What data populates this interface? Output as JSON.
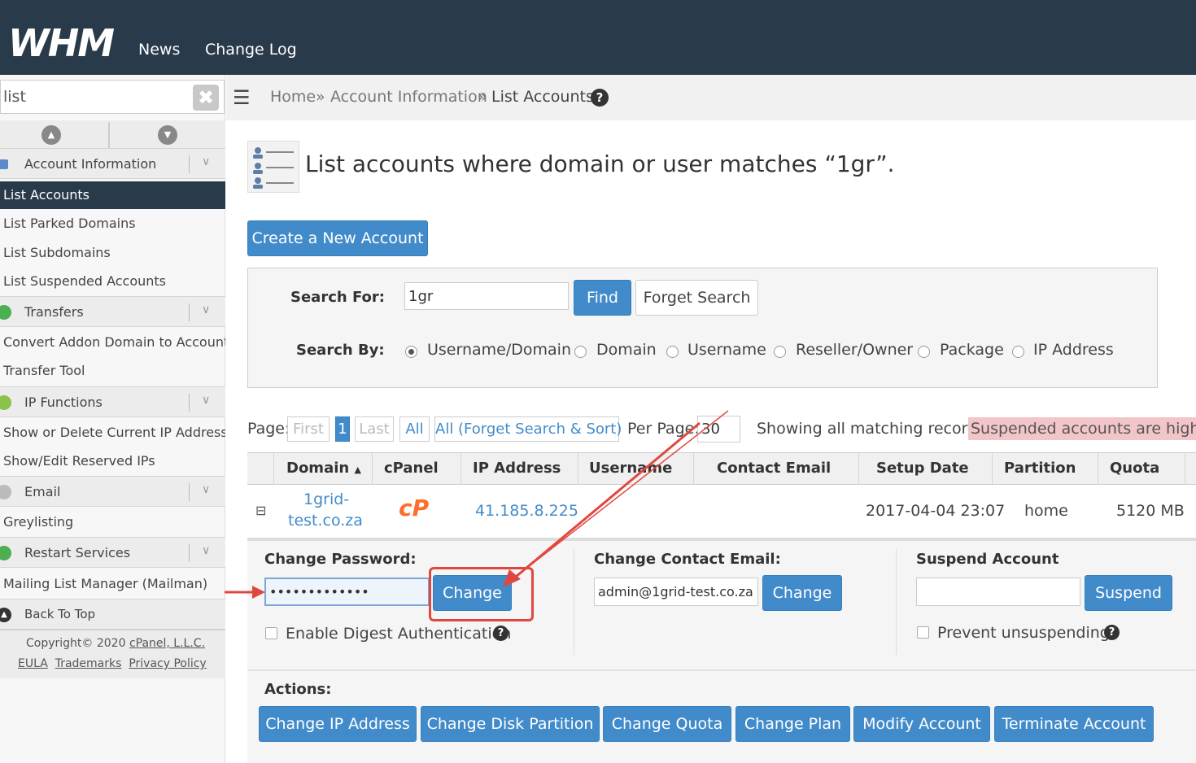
{
  "header": {
    "logo": "WHM",
    "nav": [
      "News",
      "Change Log"
    ]
  },
  "sidebar": {
    "search_value": "list",
    "groups": [
      {
        "label": "Account Information",
        "icon_color": "#5a8ac6",
        "items": [
          "List Accounts",
          "List Parked Domains",
          "List Subdomains",
          "List Suspended Accounts"
        ]
      },
      {
        "label": "Transfers",
        "icon_color": "#4caf50",
        "items": [
          "Convert Addon Domain to Account",
          "Transfer Tool"
        ]
      },
      {
        "label": "IP Functions",
        "icon_color": "#8bc34a",
        "items": [
          "Show or Delete Current IP Addresses",
          "Show/Edit Reserved IPs"
        ]
      },
      {
        "label": "Email",
        "icon_color": "#bbbbbb",
        "items": [
          "Greylisting"
        ]
      },
      {
        "label": "Restart Services",
        "icon_color": "#4caf50",
        "items": [
          "Mailing List Manager (Mailman)"
        ]
      }
    ],
    "back_to_top": "Back To Top",
    "copyright_prefix": "Copyright© 2020 ",
    "copyright_company": "cPanel, L.L.C.",
    "footer_links": [
      "EULA",
      "Trademarks",
      "Privacy Policy"
    ]
  },
  "breadcrumb": [
    "Home",
    "Account Information",
    "List Accounts"
  ],
  "page_title": "List accounts where domain or user matches “1gr”.",
  "create_button": "Create a New Account",
  "search": {
    "for_label": "Search For:",
    "value": "1gr",
    "find_button": "Find",
    "forget_button": "Forget Search",
    "by_label": "Search By:",
    "options": [
      "Username/Domain",
      "Domain",
      "Username",
      "Reseller/Owner",
      "Package",
      "IP Address"
    ],
    "selected": "Username/Domain"
  },
  "pagination": {
    "page_label": "Page:",
    "first": "First",
    "current": "1",
    "last": "Last",
    "all": "All",
    "all_forget": "All (Forget Search & Sort)",
    "per_page_label": "Per Page:",
    "per_page_value": "30",
    "showing": "Showing all matching records.",
    "suspended_note": "Suspended accounts are highlighted"
  },
  "table": {
    "columns": [
      "Domain",
      "cPanel",
      "IP Address",
      "Username",
      "Contact Email",
      "Setup Date",
      "Partition",
      "Quota"
    ],
    "row": {
      "expand": "⊟",
      "domain_line1": "1grid-",
      "domain_line2": "test.co.za",
      "cpanel": "cP",
      "ip": "41.185.8.225",
      "username": "",
      "email": "",
      "setup_date": "2017-04-04 23:07",
      "partition": "home",
      "quota": "5120 MB"
    }
  },
  "detail": {
    "password_label": "Change Password:",
    "password_value": "•••••••••••••",
    "password_button": "Change",
    "digest_label": "Enable Digest Authentication",
    "email_label": "Change Contact Email:",
    "email_value": "admin@1grid-test.co.za",
    "email_button": "Change",
    "suspend_label": "Suspend Account",
    "suspend_value": "",
    "suspend_button": "Suspend",
    "prevent_label": "Prevent unsuspending",
    "actions_label": "Actions:",
    "actions": [
      "Change IP Address",
      "Change Disk Partition",
      "Change Quota",
      "Change Plan",
      "Modify Account",
      "Terminate Account"
    ]
  },
  "colors": {
    "header_bg": "#293a4a",
    "primary": "#428bca",
    "highlight": "#f2c5c8",
    "annotation": "#e0483f",
    "cpanel_logo": "#ff6c2c"
  }
}
